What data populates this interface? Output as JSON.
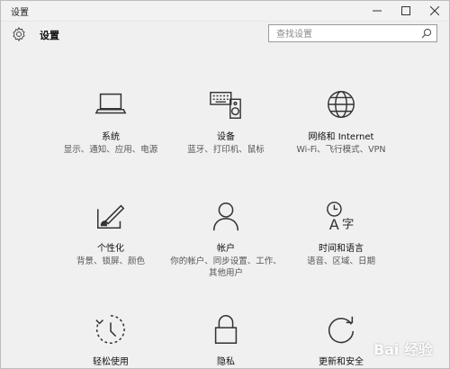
{
  "window": {
    "title": "设置"
  },
  "header": {
    "title": "设置"
  },
  "search": {
    "placeholder": "查找设置"
  },
  "tiles": [
    {
      "name": "系统",
      "desc": "显示、通知、应用、电源",
      "icon": "laptop-icon"
    },
    {
      "name": "设备",
      "desc": "蓝牙、打印机、鼠标",
      "icon": "keyboard-speaker-icon"
    },
    {
      "name": "网络和 Internet",
      "desc": "Wi-Fi、飞行模式、VPN",
      "icon": "globe-icon"
    },
    {
      "name": "个性化",
      "desc": "背景、锁屏、颜色",
      "icon": "paint-icon"
    },
    {
      "name": "帐户",
      "desc": "你的帐户、同步设置、工作、其他用户",
      "icon": "person-icon"
    },
    {
      "name": "时间和语言",
      "desc": "语音、区域、日期",
      "icon": "time-language-icon"
    },
    {
      "name": "轻松使用",
      "desc": "",
      "icon": "ease-of-access-icon"
    },
    {
      "name": "隐私",
      "desc": "",
      "icon": "lock-icon"
    },
    {
      "name": "更新和安全",
      "desc": "",
      "icon": "sync-icon"
    }
  ],
  "watermark": {
    "text": "Bai 经验"
  }
}
